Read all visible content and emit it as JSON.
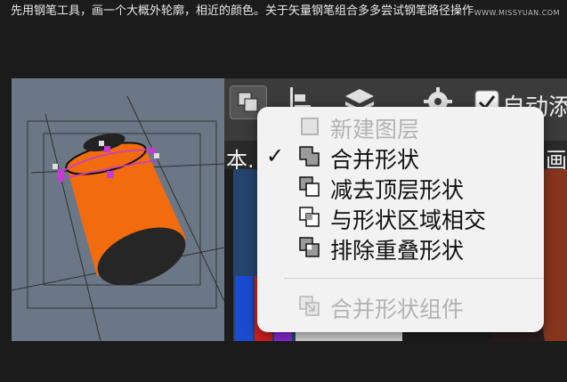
{
  "caption": "先用钢笔工具，画一个大概外轮廓，相近的颜色。关于矢量钢笔组合多多尝试钢笔路径操作",
  "watermark": "WWW.MISSYUAN.COM",
  "toolbar": {
    "auto_add_label": "自动添",
    "auto_add_checked": true
  },
  "tabs": {
    "left_fragment": "本.",
    "right_fragment": "画"
  },
  "menu": {
    "items": [
      {
        "label": "新建图层",
        "checked": false,
        "disabled": true,
        "icon": "new-layer-icon"
      },
      {
        "label": "合并形状",
        "checked": true,
        "disabled": false,
        "icon": "combine-shapes-icon"
      },
      {
        "label": "减去顶层形状",
        "checked": false,
        "disabled": false,
        "icon": "subtract-front-shape-icon"
      },
      {
        "label": "与形状区域相交",
        "checked": false,
        "disabled": false,
        "icon": "intersect-shape-areas-icon"
      },
      {
        "label": "排除重叠形状",
        "checked": false,
        "disabled": false,
        "icon": "exclude-overlapping-shapes-icon"
      },
      {
        "label": "合并形状组件",
        "checked": false,
        "disabled": true,
        "icon": "merge-shape-components-icon"
      }
    ]
  },
  "colors": {
    "canvas_bg": "#6b7786",
    "shape_orange": "#f26b0e",
    "shape_dark": "#262626",
    "path_magenta": "#c43bd6",
    "menu_bg": "#f2f2f2"
  }
}
